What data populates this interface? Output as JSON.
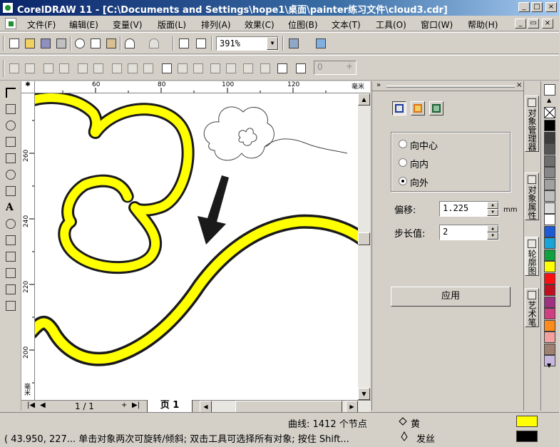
{
  "window": {
    "title": "CorelDRAW 11 - [C:\\Documents and Settings\\hope1\\桌面\\painter练习文件\\cloud3.cdr]",
    "minimize_glyph": "_",
    "maximize_glyph": "□",
    "close_glyph": "×"
  },
  "menu": {
    "items": [
      "文件(F)",
      "编辑(E)",
      "变量(V)",
      "版面(L)",
      "排列(A)",
      "效果(C)",
      "位图(B)",
      "文本(T)",
      "工具(O)",
      "窗口(W)",
      "帮助(H)"
    ],
    "doc_minimize_glyph": "_",
    "doc_restore_glyph": "▭",
    "doc_close_glyph": "×"
  },
  "toolbar": {
    "zoom_value": "391%",
    "angle_value": "0"
  },
  "rulers": {
    "h_ticks": [
      "60",
      "80",
      "100",
      "120"
    ],
    "h_unit": "毫米",
    "v_ticks": [
      "260",
      "240",
      "220",
      "200"
    ],
    "v_unit": "毫米"
  },
  "page_nav": {
    "count": "1 / 1",
    "tab": "页 1"
  },
  "contour_docker": {
    "direction_options": [
      "向中心",
      "向内",
      "向外"
    ],
    "selected_direction": "向外",
    "offset_label": "偏移:",
    "offset_value": "1.225",
    "offset_unit": "mm",
    "steps_label": "步长值:",
    "steps_value": "2",
    "apply_label": "应用"
  },
  "side_tabs": [
    "对象管理器",
    "对象属性",
    "轮廓图",
    "艺术笔"
  ],
  "palette": {
    "colors": [
      "#000000",
      "#3c3c3c",
      "#555555",
      "#6e6e6e",
      "#878787",
      "#a0a0a0",
      "#bebebe",
      "#dcdcdc",
      "#ffffff",
      "#1d5bd6",
      "#18a4d8",
      "#10a040",
      "#ffff00",
      "#ff1010",
      "#c01020",
      "#a03080",
      "#d04080",
      "#ff8c1a",
      "#f4a0a0",
      "#a08070",
      "#c8b8e0"
    ]
  },
  "status": {
    "object_info": "曲线:  1412 个节点",
    "fill_name": "黄",
    "fill_color": "#ffff00",
    "outline_name": "发丝",
    "outline_color": "#000000",
    "hint": "( 43.950, 227... 单击对象两次可旋转/倾斜; 双击工具可选择所有对象; 按住 Shift..."
  }
}
